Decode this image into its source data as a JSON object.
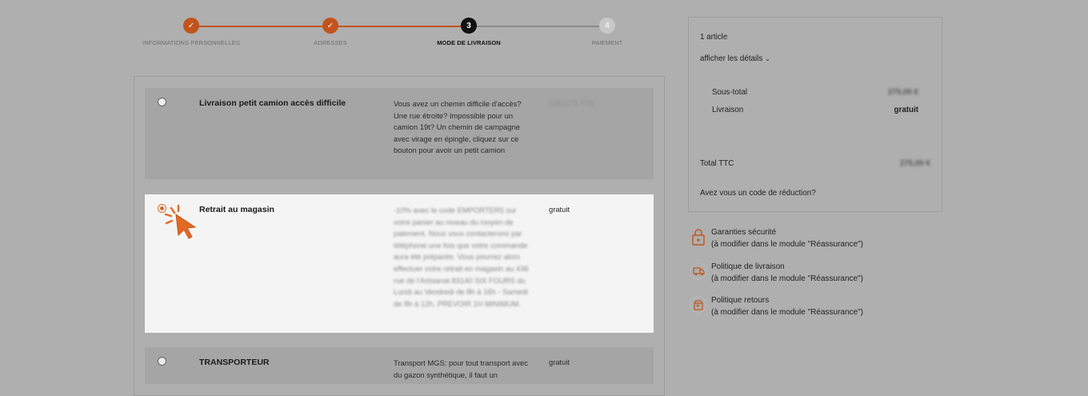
{
  "stepper": {
    "steps": [
      {
        "number": "✓",
        "label": "INFORMATIONS PERSONNELLES",
        "state": "done"
      },
      {
        "number": "✓",
        "label": "ADRESSES",
        "state": "done"
      },
      {
        "number": "3",
        "label": "MODE DE LIVRAISON",
        "state": "current"
      },
      {
        "number": "4",
        "label": "PAIEMENT",
        "state": "todo"
      }
    ],
    "colors": {
      "done": "#c1541c",
      "current": "#111111",
      "todo": "#c8c8c8"
    }
  },
  "carriers": [
    {
      "name": "Livraison petit camion accès difficile",
      "description": "Vous avez un chemin difficile d'accès? Une rue étroite? Impossible pour un camion 19t? Un chemin de campagne avec virage en épingle, cliquez sur ce bouton pour avoir un petit camion",
      "price": "226,17 € TTC",
      "selected": false
    },
    {
      "name": "Retrait au magasin",
      "description": "-10% avec le code EMPORTER5 sur votre panier au niveau du moyen de paiement. Nous vous contacterons par téléphone une fois que votre commande aura été préparée. Vous pourrez alors effectuer votre retrait en magasin au 436 rue de l'Artisanat 83140 SIX FOURS du Lundi au Vendredi de 8h à 16h - Samedi de 8h à 12h. PREVOIR 1H MINIMUM.",
      "price": "gratuit",
      "selected": true
    },
    {
      "name": "TRANSPORTEUR",
      "description": "Transport MGS: pour tout transport avec du gazon synthétique, il faut un",
      "price": "gratuit",
      "selected": false
    }
  ],
  "summary": {
    "item_count": "1 article",
    "details_link": "afficher les détails",
    "subtotal_label": "Sous-total",
    "subtotal_value": "275,00 €",
    "shipping_label": "Livraison",
    "shipping_value": "gratuit",
    "total_label": "Total TTC",
    "total_value": "275,00 €",
    "promo_link": "Avez vous un code de réduction?"
  },
  "reassurance": [
    {
      "title": "Garanties sécurité",
      "subtitle": "(à modifier dans le module \"Réassurance\")",
      "icon": "lock-icon"
    },
    {
      "title": "Politique de livraison",
      "subtitle": "(à modifier dans le module \"Réassurance\")",
      "icon": "truck-icon"
    },
    {
      "title": "Politique retours",
      "subtitle": "(à modifier dans le module \"Réassurance\")",
      "icon": "return-box-icon"
    }
  ],
  "accent_color": "#d0672b"
}
